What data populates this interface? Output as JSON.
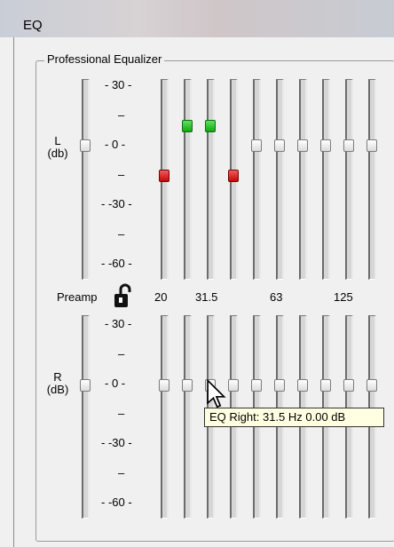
{
  "window": {
    "title": "EQ"
  },
  "group": {
    "title": "Professional Equalizer"
  },
  "left_channel": {
    "label_line1": "L",
    "label_line2": "(db)",
    "ticks": [
      "30",
      "–",
      "0",
      "–",
      "-30",
      "–",
      "-60"
    ]
  },
  "right_channel": {
    "label_line1": "R",
    "label_line2": "(dB)",
    "ticks": [
      "30",
      "–",
      "0",
      "–",
      "-30",
      "–",
      "-60"
    ]
  },
  "middle": {
    "preamp_label": "Preamp",
    "freq_labels": [
      "20",
      "31.5",
      "63",
      "125"
    ]
  },
  "left_bands_db": [
    0,
    -3,
    2,
    2,
    -3,
    0,
    0,
    0,
    0,
    0,
    0
  ],
  "right_bands_db": [
    0,
    0,
    0,
    0,
    0,
    0,
    0,
    0,
    0,
    0,
    0
  ],
  "tooltip": {
    "text": "EQ Right: 31.5 Hz  0.00 dB"
  },
  "colors": {
    "raised": "#1cbf1c",
    "lowered": "#d81010",
    "neutral": "#ffffff"
  }
}
